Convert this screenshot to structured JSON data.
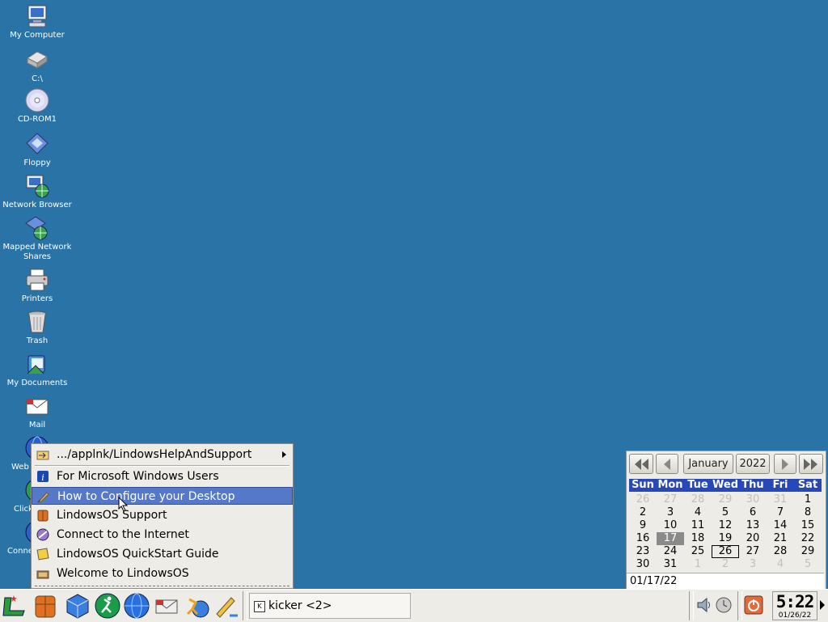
{
  "desktop": {
    "icons": [
      {
        "label": "My Computer"
      },
      {
        "label": "C:\\"
      },
      {
        "label": "CD-ROM1"
      },
      {
        "label": "Floppy"
      },
      {
        "label": "Network Browser"
      },
      {
        "label": "Mapped Network Shares"
      },
      {
        "label": "Printers"
      },
      {
        "label": "Trash"
      },
      {
        "label": "My Documents"
      },
      {
        "label": "Mail"
      },
      {
        "label": "Web"
      },
      {
        "label": "Click"
      },
      {
        "label": "Conne Inte"
      }
    ]
  },
  "menu": {
    "items": [
      {
        "label": ".../applnk/LindowsHelpAndSupport",
        "icon": "folder-arrow-icon"
      },
      {
        "label": "For Microsoft Windows Users",
        "icon": "info-icon"
      },
      {
        "label": "How to Configure your Desktop",
        "icon": "brush-icon"
      },
      {
        "label": "LindowsOS Support",
        "icon": "lifevest-icon"
      },
      {
        "label": "Connect to the Internet",
        "icon": "connect-icon"
      },
      {
        "label": "LindowsOS QuickStart Guide",
        "icon": "guide-icon"
      },
      {
        "label": "Welcome to LindowsOS",
        "icon": "welcome-icon"
      }
    ]
  },
  "calendar": {
    "month": "January",
    "year": "2022",
    "day_headers": [
      "Sun",
      "Mon",
      "Tue",
      "Wed",
      "Thu",
      "Fri",
      "Sat"
    ],
    "weeks": [
      [
        "26",
        "27",
        "28",
        "29",
        "30",
        "31",
        "1"
      ],
      [
        "2",
        "3",
        "4",
        "5",
        "6",
        "7",
        "8"
      ],
      [
        "9",
        "10",
        "11",
        "12",
        "13",
        "14",
        "15"
      ],
      [
        "16",
        "17",
        "18",
        "19",
        "20",
        "21",
        "22"
      ],
      [
        "23",
        "24",
        "25",
        "26",
        "27",
        "28",
        "29"
      ],
      [
        "30",
        "31",
        "1",
        "2",
        "3",
        "4",
        "5"
      ]
    ],
    "selected_date": "01/17/22"
  },
  "taskbar": {
    "task_label": "kicker <2>",
    "clock_time": "5:22",
    "clock_date": "01/26/22"
  },
  "colors": {
    "desktop_bg": "#2a73a6",
    "highlight": "#5579c8",
    "cal_header": "#2848b8"
  }
}
